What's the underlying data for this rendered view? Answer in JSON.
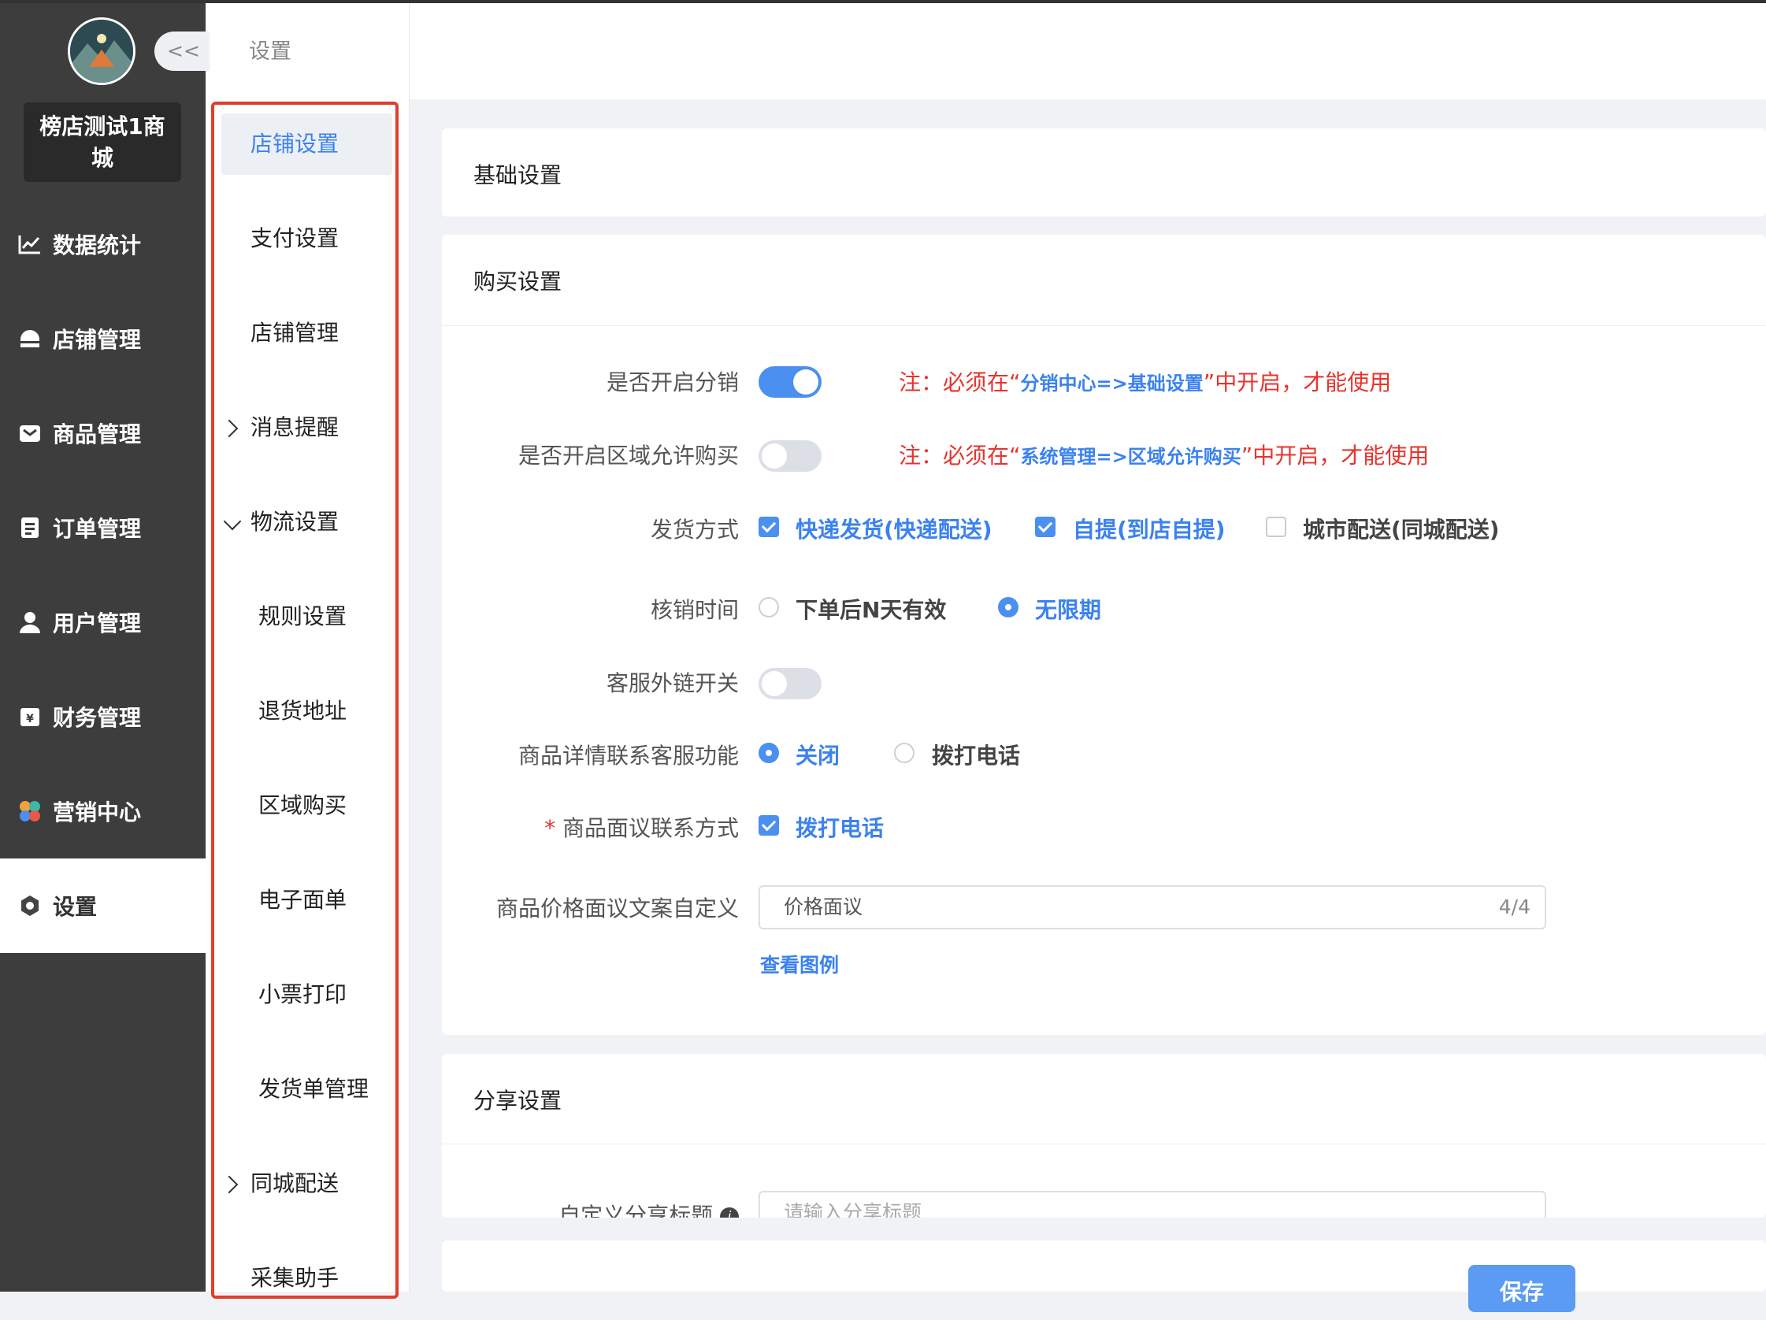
{
  "sidebar": {
    "shop_name": "榜店测试1商城",
    "items": [
      {
        "label": "数据统计",
        "icon": "chart-icon"
      },
      {
        "label": "店铺管理",
        "icon": "store-icon"
      },
      {
        "label": "商品管理",
        "icon": "goods-icon"
      },
      {
        "label": "订单管理",
        "icon": "order-icon"
      },
      {
        "label": "用户管理",
        "icon": "user-icon"
      },
      {
        "label": "财务管理",
        "icon": "finance-icon"
      },
      {
        "label": "营销中心",
        "icon": "marketing-icon"
      },
      {
        "label": "设置",
        "icon": "settings-icon",
        "active": true
      }
    ]
  },
  "submenu": {
    "title": "设置",
    "collapse_label": "<<",
    "items": [
      {
        "label": "店铺设置",
        "active": true
      },
      {
        "label": "支付设置"
      },
      {
        "label": "店铺管理"
      },
      {
        "label": "消息提醒",
        "expandable": "collapsed"
      },
      {
        "label": "物流设置",
        "expandable": "expanded"
      },
      {
        "label": "规则设置",
        "child": true
      },
      {
        "label": "退货地址",
        "child": true
      },
      {
        "label": "区域购买",
        "child": true
      },
      {
        "label": "电子面单",
        "child": true
      },
      {
        "label": "小票打印",
        "child": true
      },
      {
        "label": "发货单管理",
        "child": true
      },
      {
        "label": "同城配送",
        "expandable": "collapsed"
      },
      {
        "label": "采集助手"
      }
    ]
  },
  "content": {
    "basic_title": "基础设置",
    "purchase_title": "购买设置",
    "share_title": "分享设置",
    "rows": {
      "distribution": {
        "label": "是否开启分销",
        "enabled": true,
        "note_prefix": "注：必须在“",
        "note_link": "分销中心=>基础设置",
        "note_suffix": "”中开启，才能使用"
      },
      "region": {
        "label": "是否开启区域允许购买",
        "enabled": false,
        "note_prefix": "注：必须在“",
        "note_link": "系统管理=>区域允许购买",
        "note_suffix": "”中开启，才能使用"
      },
      "delivery": {
        "label": "发货方式",
        "options": [
          {
            "label": "快递发货(快递配送)",
            "checked": true
          },
          {
            "label": "自提(到店自提)",
            "checked": true
          },
          {
            "label": "城市配送(同城配送)",
            "checked": false
          }
        ]
      },
      "verify_time": {
        "label": "核销时间",
        "options": [
          {
            "label": "下单后N天有效",
            "selected": false
          },
          {
            "label": "无限期",
            "selected": true
          }
        ]
      },
      "service_link": {
        "label": "客服外链开关",
        "enabled": false
      },
      "detail_service": {
        "label": "商品详情联系客服功能",
        "options": [
          {
            "label": "关闭",
            "selected": true
          },
          {
            "label": "拨打电话",
            "selected": false
          }
        ]
      },
      "negotiation": {
        "required_mark": "*",
        "label": "商品面议联系方式",
        "option": {
          "label": "拨打电话",
          "checked": true
        }
      },
      "price_text": {
        "label": "商品价格面议文案自定义",
        "value": "价格面议",
        "counter": "4/4",
        "example_link": "查看图例"
      },
      "share_title": {
        "label": "自定义分享标题",
        "placeholder": "请输入分享标题"
      }
    },
    "save_label": "保存"
  },
  "colors": {
    "accent": "#4b8ff0",
    "note_red": "#e8332d",
    "sidebar_bg": "#3d3d3d",
    "highlight_frame": "#e13d2e"
  }
}
